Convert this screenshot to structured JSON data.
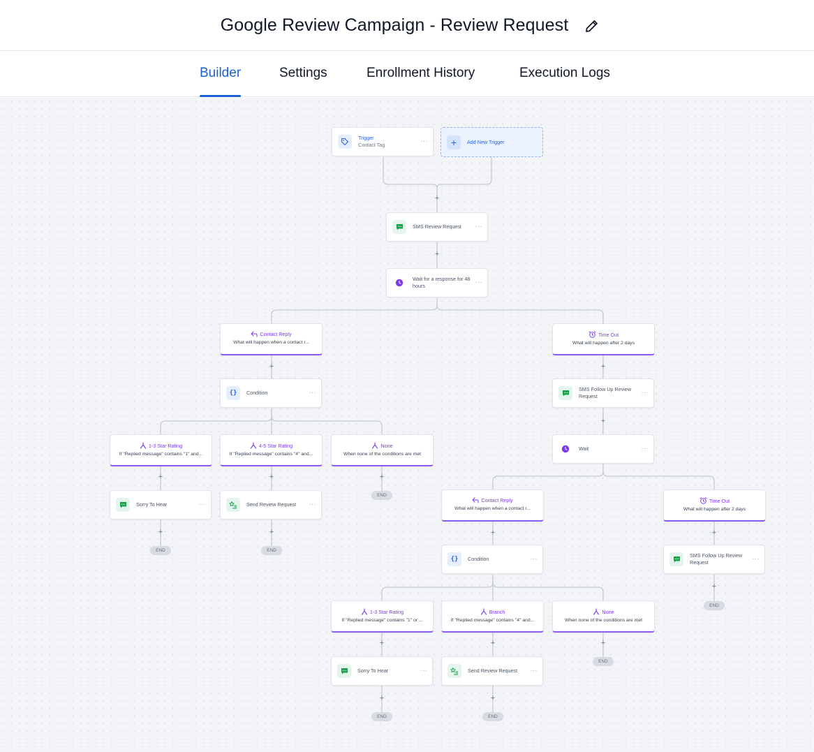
{
  "header": {
    "title": "Google Review Campaign - Review Request",
    "edit_icon": "pencil-icon"
  },
  "tabs": [
    {
      "label": "Builder",
      "active": true
    },
    {
      "label": "Settings",
      "active": false
    },
    {
      "label": "Enrollment History",
      "active": false
    },
    {
      "label": "Execution Logs",
      "active": false
    }
  ],
  "colors": {
    "accent": "#1d5fd3",
    "branch_border": "#8b5cf6",
    "sms_icon": "#16a34a",
    "wait_icon": "#7c3aed",
    "condition_icon": "#2563eb"
  },
  "workflow": {
    "trigger": {
      "type_label": "Trigger",
      "name": "Contact Tag",
      "icon": "tag-icon"
    },
    "add_trigger": {
      "label": "Add New Trigger",
      "icon": "plus-icon"
    },
    "sms_review_request": {
      "label": "SMS Review Request",
      "icon": "sms-icon"
    },
    "wait_response": {
      "label": "Wait for a response for 48 hours",
      "icon": "clock-icon"
    },
    "contact_reply_1": {
      "title": "Contact Reply",
      "subtitle": "What will happen when a contact r...",
      "icon": "reply-icon"
    },
    "time_out_1": {
      "title": "Time Out",
      "subtitle": "What will happen after 2 days",
      "icon": "alarm-icon"
    },
    "condition_1": {
      "label": "Condition",
      "icon": "braces-icon"
    },
    "sms_follow_up_1": {
      "label": "SMS Follow Up Review Request",
      "icon": "sms-icon"
    },
    "wait_2": {
      "label": "Wait",
      "icon": "clock-icon"
    },
    "rating_1_3_a": {
      "title": "1-3 Star Rating",
      "subtitle": "If \"Replied message\" contains \"1\" and...",
      "icon": "branch-icon"
    },
    "rating_4_5": {
      "title": "4-5 Star Rating",
      "subtitle": "If \"Replied message\" contains \"4\" and...",
      "icon": "branch-icon"
    },
    "none_1": {
      "title": "None",
      "subtitle": "When none of the conditions are met",
      "icon": "branch-icon"
    },
    "sorry_a": {
      "label": "Sorry To Hear",
      "icon": "sms-icon"
    },
    "send_review_a": {
      "label": "Send Review Request",
      "icon": "star-list-icon"
    },
    "contact_reply_2": {
      "title": "Contact Reply",
      "subtitle": "What will happen when a contact r...",
      "icon": "reply-icon"
    },
    "time_out_2": {
      "title": "Time Out",
      "subtitle": "What will happen after 2 days",
      "icon": "alarm-icon"
    },
    "condition_2": {
      "label": "Condition",
      "icon": "braces-icon"
    },
    "sms_follow_up_2": {
      "label": "SMS Follow Up Review Request",
      "icon": "sms-icon"
    },
    "rating_1_3_b": {
      "title": "1-3 Star Rating",
      "subtitle": "If \"Replied message\" contains \"1\" or ...",
      "icon": "branch-icon"
    },
    "branch_b": {
      "title": "Branch",
      "subtitle": "If \"Replied message\" contains \"4\" and...",
      "icon": "branch-icon"
    },
    "none_2": {
      "title": "None",
      "subtitle": "When none of the conditions are met",
      "icon": "branch-icon"
    },
    "sorry_b": {
      "label": "Sorry To Hear",
      "icon": "sms-icon"
    },
    "send_review_b": {
      "label": "Send Review Request",
      "icon": "star-list-icon"
    },
    "end_label": "END",
    "plus_label": "+",
    "more_label": "···"
  }
}
